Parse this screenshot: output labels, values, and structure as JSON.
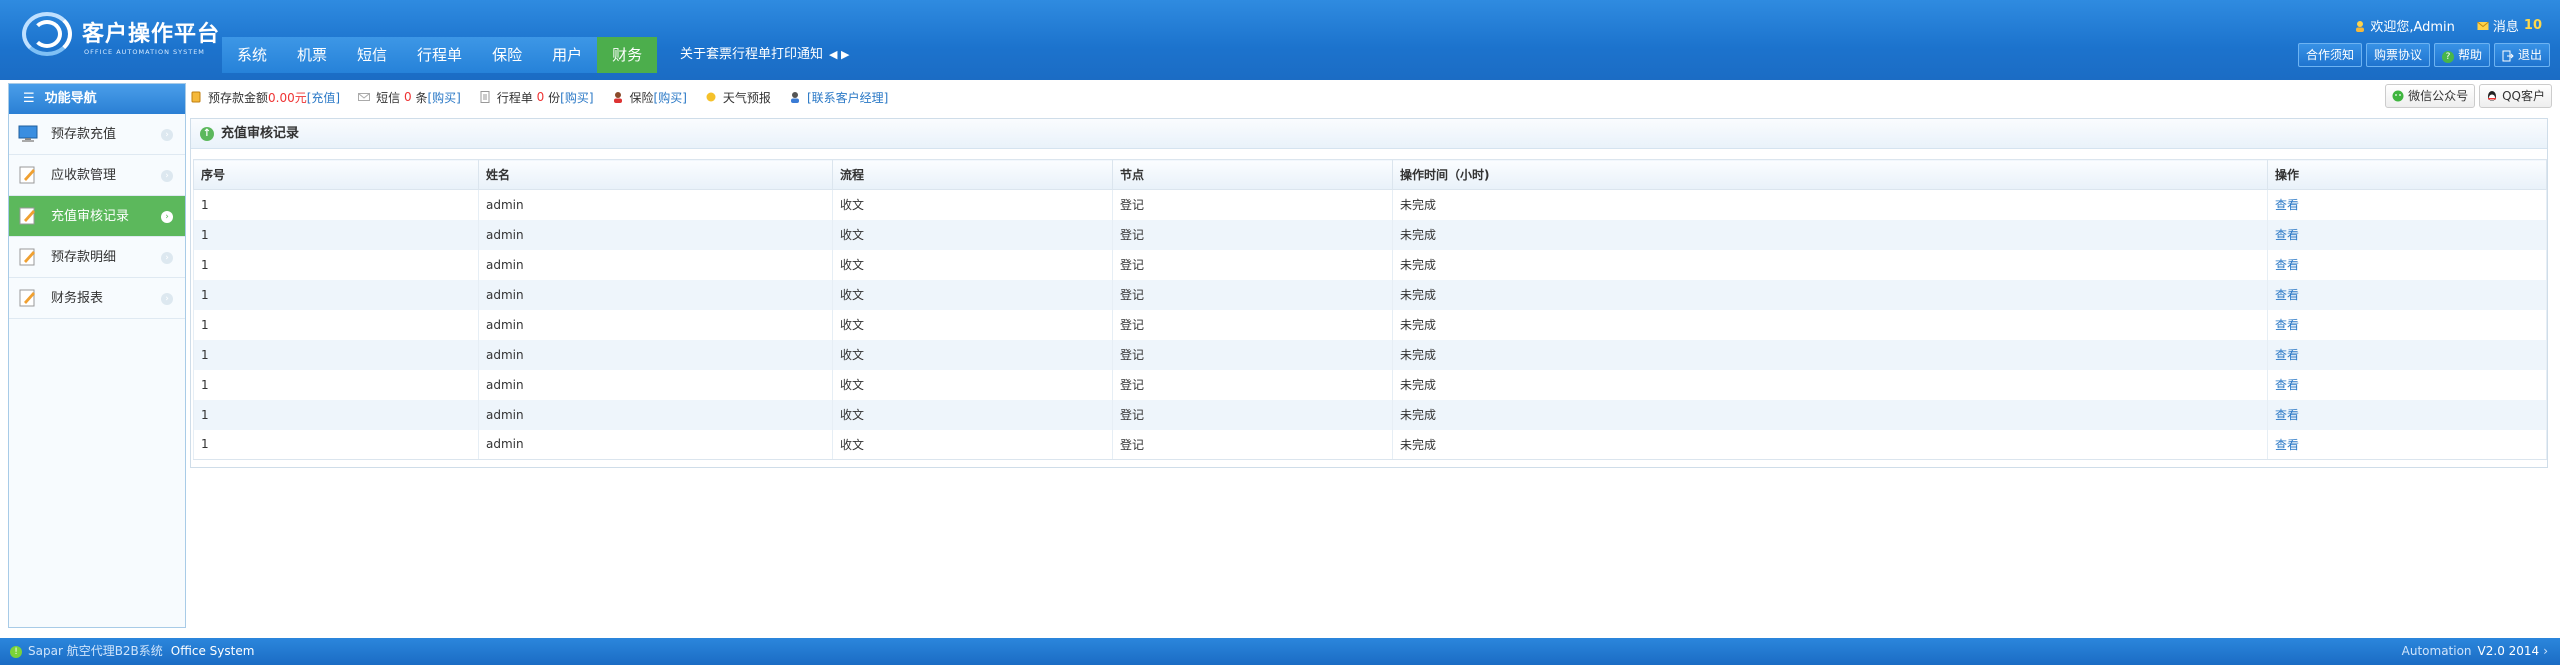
{
  "app": {
    "title": "客户操作平台",
    "subtitle": "OFFICE AUTOMATION SYSTEM"
  },
  "topnav": [
    "系统",
    "机票",
    "短信",
    "行程单",
    "保险",
    "用户",
    "财务"
  ],
  "topnav_active": "财务",
  "notice": "关于套票行程单打印通知",
  "notice_arrows": "◀ ▶",
  "user": {
    "welcome": "欢迎您,Admin",
    "messages_label": "消息",
    "messages_count": "10"
  },
  "top_buttons": [
    "合作须知",
    "购票协议",
    "帮助",
    "退出"
  ],
  "sidebar": {
    "title": "功能导航",
    "items": [
      {
        "label": "预存款充值",
        "icon": "monitor-icon",
        "active": false
      },
      {
        "label": "应收款管理",
        "icon": "edit-icon",
        "active": false
      },
      {
        "label": "充值审核记录",
        "icon": "edit-icon",
        "active": true
      },
      {
        "label": "预存款明细",
        "icon": "edit-icon",
        "active": false
      },
      {
        "label": "财务报表",
        "icon": "edit-icon",
        "active": false
      }
    ]
  },
  "infobar": {
    "deposit_label": "预存款金额",
    "deposit_amount": "0.00元",
    "deposit_link": "[充值]",
    "sms_label": "短信",
    "sms_count": "0",
    "sms_unit": "条",
    "sms_link": "[购买]",
    "itinerary_label": "行程单",
    "itinerary_count": "0",
    "itinerary_unit": "份",
    "itinerary_link": "[购买]",
    "insurance_label": "保险",
    "insurance_link": "[购买]",
    "weather_label": "天气预报",
    "contact_link": "[联系客户经理]"
  },
  "share_buttons": {
    "wechat": "微信公众号",
    "qq": "QQ客户"
  },
  "panel": {
    "title": "充值审核记录"
  },
  "table": {
    "columns": [
      "序号",
      "姓名",
      "流程",
      "节点",
      "操作时间（小时)",
      "操作"
    ],
    "rows": [
      [
        "1",
        "admin",
        "收文",
        "登记",
        "未完成",
        "查看"
      ],
      [
        "1",
        "admin",
        "收文",
        "登记",
        "未完成",
        "查看"
      ],
      [
        "1",
        "admin",
        "收文",
        "登记",
        "未完成",
        "查看"
      ],
      [
        "1",
        "admin",
        "收文",
        "登记",
        "未完成",
        "查看"
      ],
      [
        "1",
        "admin",
        "收文",
        "登记",
        "未完成",
        "查看"
      ],
      [
        "1",
        "admin",
        "收文",
        "登记",
        "未完成",
        "查看"
      ],
      [
        "1",
        "admin",
        "收文",
        "登记",
        "未完成",
        "查看"
      ],
      [
        "1",
        "admin",
        "收文",
        "登记",
        "未完成",
        "查看"
      ],
      [
        "1",
        "admin",
        "收文",
        "登记",
        "未完成",
        "查看"
      ]
    ]
  },
  "footer": {
    "left_text": "Sapar 航空代理B2B系统",
    "system": "Office System",
    "right_text": "Automation",
    "version": "V2.0 2014"
  },
  "colors": {
    "header_blue": "#1c73cd",
    "active_green": "#5cb85c",
    "link_blue": "#2a78c6",
    "amount_red": "#ee3333"
  }
}
